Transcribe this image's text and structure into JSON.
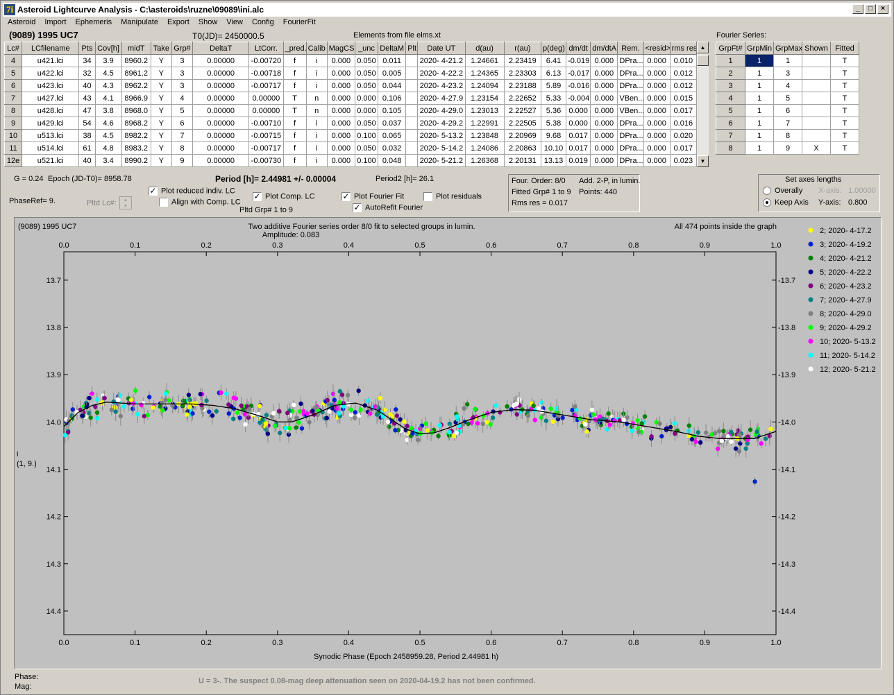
{
  "window": {
    "title": "Asteroid Lightcurve Analysis - C:\\asteroids\\ruzne\\09089\\ini.alc",
    "icon_glyph": "7i"
  },
  "menu": [
    "Asteroid",
    "Import",
    "Ephemeris",
    "Manipulate",
    "Export",
    "Show",
    "View",
    "Config",
    "FourierFit"
  ],
  "header": {
    "asteroid": "(9089) 1995 UC7",
    "t0": "T0(JD)= 2450000.5",
    "elements": "Elements from file elms.xt",
    "fourier_label": "Fourier Series:"
  },
  "lc_table": {
    "columns": [
      "Lc#",
      "LCfilename",
      "Pts",
      "Cov[h]",
      "midT",
      "Take",
      "Grp#",
      "DeltaT",
      "LtCorr.",
      "_pred.",
      "Calib",
      "MagCS",
      "_unc",
      "DeltaM",
      "Plt",
      "Date UT",
      "d(au)",
      "r(au)",
      "p(deg)",
      "dm/dt",
      "dm/dtA",
      "Rem.",
      "<resid>",
      "rms res"
    ],
    "rows": [
      [
        "4",
        "u421.lci",
        "34",
        "3.9",
        "8960.2",
        "Y",
        "3",
        "0.00000",
        "-0.00720",
        "f",
        "i",
        "0.000",
        "0.050",
        "0.011",
        "",
        "2020- 4-21.2",
        "1.24661",
        "2.23419",
        "6.41",
        "-0.019",
        "0.000",
        "DPra...",
        "0.000",
        "0.010"
      ],
      [
        "5",
        "u422.lci",
        "32",
        "4.5",
        "8961.2",
        "Y",
        "3",
        "0.00000",
        "-0.00718",
        "f",
        "i",
        "0.000",
        "0.050",
        "0.005",
        "",
        "2020- 4-22.2",
        "1.24365",
        "2.23303",
        "6.13",
        "-0.017",
        "0.000",
        "DPra...",
        "0.000",
        "0.012"
      ],
      [
        "6",
        "u423.lci",
        "40",
        "4.3",
        "8962.2",
        "Y",
        "3",
        "0.00000",
        "-0.00717",
        "f",
        "i",
        "0.000",
        "0.050",
        "0.044",
        "",
        "2020- 4-23.2",
        "1.24094",
        "2.23188",
        "5.89",
        "-0.016",
        "0.000",
        "DPra...",
        "0.000",
        "0.012"
      ],
      [
        "7",
        "u427.lci",
        "43",
        "4.1",
        "8966.9",
        "Y",
        "4",
        "0.00000",
        "0.00000",
        "T",
        "n",
        "0.000",
        "0.000",
        "0.106",
        "",
        "2020- 4-27.9",
        "1.23154",
        "2.22652",
        "5.33",
        "-0.004",
        "0.000",
        "VBen...",
        "0.000",
        "0.015"
      ],
      [
        "8",
        "u428.lci",
        "47",
        "3.8",
        "8968.0",
        "Y",
        "5",
        "0.00000",
        "0.00000",
        "T",
        "n",
        "0.000",
        "0.000",
        "0.105",
        "",
        "2020- 4-29.0",
        "1.23013",
        "2.22527",
        "5.36",
        "0.000",
        "0.000",
        "VBen...",
        "0.000",
        "0.017"
      ],
      [
        "9",
        "u429.lci",
        "54",
        "4.6",
        "8968.2",
        "Y",
        "6",
        "0.00000",
        "-0.00710",
        "f",
        "i",
        "0.000",
        "0.050",
        "0.037",
        "",
        "2020- 4-29.2",
        "1.22991",
        "2.22505",
        "5.38",
        "0.000",
        "0.000",
        "DPra...",
        "0.000",
        "0.016"
      ],
      [
        "10",
        "u513.lci",
        "38",
        "4.5",
        "8982.2",
        "Y",
        "7",
        "0.00000",
        "-0.00715",
        "f",
        "i",
        "0.000",
        "0.100",
        "0.065",
        "",
        "2020- 5-13.2",
        "1.23848",
        "2.20969",
        "9.68",
        "0.017",
        "0.000",
        "DPra...",
        "0.000",
        "0.020"
      ],
      [
        "11",
        "u514.lci",
        "61",
        "4.8",
        "8983.2",
        "Y",
        "8",
        "0.00000",
        "-0.00717",
        "f",
        "i",
        "0.000",
        "0.050",
        "0.032",
        "",
        "2020- 5-14.2",
        "1.24086",
        "2.20863",
        "10.10",
        "0.017",
        "0.000",
        "DPra...",
        "0.000",
        "0.017"
      ],
      [
        "12e",
        "u521.lci",
        "40",
        "3.4",
        "8990.2",
        "Y",
        "9",
        "0.00000",
        "-0.00730",
        "f",
        "i",
        "0.000",
        "0.100",
        "0.048",
        "",
        "2020- 5-21.2",
        "1.26368",
        "2.20131",
        "13.13",
        "0.019",
        "0.000",
        "DPra...",
        "0.000",
        "0.023"
      ]
    ]
  },
  "fourier_table": {
    "columns": [
      "GrpFt#",
      "GrpMin",
      "GrpMax",
      "Shown",
      "Fitted"
    ],
    "rows": [
      [
        "1",
        "1",
        "1",
        "",
        "T"
      ],
      [
        "2",
        "1",
        "3",
        "",
        "T"
      ],
      [
        "3",
        "1",
        "4",
        "",
        "T"
      ],
      [
        "4",
        "1",
        "5",
        "",
        "T"
      ],
      [
        "5",
        "1",
        "6",
        "",
        "T"
      ],
      [
        "6",
        "1",
        "7",
        "",
        "T"
      ],
      [
        "7",
        "1",
        "8",
        "",
        "T"
      ],
      [
        "8",
        "1",
        "9",
        "X",
        "T"
      ]
    ]
  },
  "controls": {
    "g": "G = 0.24",
    "epoch": "Epoch (JD-T0)= 8958.78",
    "period": "Period [h]= 2.44981 +/- 0.00004",
    "period2": "Period2 [h]= 26.1",
    "phaseref": "PhaseRef= 9.",
    "pltd_lc": "Pltd Lc#:",
    "pltd_grp": "Pltd Grp#  1   to   9",
    "plot_reduced": "Plot reduced indiv. LC",
    "align_comp": "Align with Comp. LC",
    "plot_comp": "Plot Comp. LC",
    "plot_fourier": "Plot Fourier Fit",
    "autorefit": "AutoRefit Fourier",
    "plot_residuals": "Plot residuals",
    "fit_info": [
      "Four. Order:  8/0",
      "Add. 2-P, in lumin.",
      "Fitted Grp# 1 to 9",
      "Points: 440",
      "Rms res     = 0.017"
    ],
    "axes_title": "Set axes lengths",
    "overally": "Overally",
    "keep_axis": "Keep Axis",
    "xaxis_label": "X-axis:",
    "xaxis_val": "1.00000",
    "yaxis_label": "Y-axis:",
    "yaxis_val": "0.800"
  },
  "plot": {
    "name": "(9089) 1995 UC7",
    "subtitle1": "Two additive Fourier series order 8/0 fit to selected groups in lumin.",
    "subtitle2": "Amplitude: 0.083",
    "inside": "All 474 points inside the graph",
    "xlabel": "Synodic Phase (Epoch 2458959.28, Period 2.44981 h)",
    "ylabel1": "i",
    "ylabel2": "(1, 9.)"
  },
  "chart_data": {
    "type": "scatter",
    "xlim": [
      0,
      1
    ],
    "ylim": [
      14.45,
      13.64
    ],
    "x_ticks": [
      0.0,
      0.1,
      0.2,
      0.3,
      0.4,
      0.5,
      0.6,
      0.7,
      0.8,
      0.9,
      1.0
    ],
    "y_ticks": [
      13.7,
      13.8,
      13.9,
      14.0,
      14.1,
      14.2,
      14.3,
      14.4
    ],
    "fourier_fit": {
      "x": [
        0,
        0.02,
        0.04,
        0.06,
        0.08,
        0.1,
        0.12,
        0.15,
        0.18,
        0.21,
        0.24,
        0.27,
        0.3,
        0.32,
        0.35,
        0.38,
        0.41,
        0.44,
        0.46,
        0.48,
        0.5,
        0.52,
        0.54,
        0.57,
        0.6,
        0.63,
        0.66,
        0.7,
        0.74,
        0.78,
        0.82,
        0.86,
        0.89,
        0.92,
        0.95,
        0.97,
        1.0
      ],
      "y": [
        14.01,
        13.98,
        13.965,
        13.958,
        13.96,
        13.962,
        13.962,
        13.962,
        13.962,
        13.965,
        13.972,
        13.985,
        14.0,
        14.0,
        13.985,
        13.965,
        13.96,
        13.975,
        13.995,
        14.015,
        14.025,
        14.023,
        14.013,
        13.995,
        13.98,
        13.974,
        13.975,
        13.985,
        13.995,
        14.0,
        14.01,
        14.02,
        14.03,
        14.035,
        14.035,
        14.035,
        14.02
      ]
    },
    "series": [
      {
        "name": "2; 2020- 4-17.2",
        "color": "#ffff00"
      },
      {
        "name": "3; 2020- 4-19.2",
        "color": "#0020d0"
      },
      {
        "name": "4; 2020- 4-21.2",
        "color": "#008000"
      },
      {
        "name": "5; 2020- 4-22.2",
        "color": "#000080"
      },
      {
        "name": "6; 2020- 4-23.2",
        "color": "#800080"
      },
      {
        "name": "7; 2020- 4-27.9",
        "color": "#008080"
      },
      {
        "name": "8; 2020- 4-29.0",
        "color": "#808080"
      },
      {
        "name": "9; 2020- 4-29.2",
        "color": "#00ff00"
      },
      {
        "name": "10; 2020- 5-13.2",
        "color": "#ff00ff"
      },
      {
        "name": "11; 2020- 5-14.2",
        "color": "#00ffff"
      },
      {
        "name": "12; 2020- 5-21.2",
        "color": "#ffffff"
      }
    ],
    "point_count": 474
  },
  "status": {
    "phase_label": "Phase:",
    "mag_label": "Mag:",
    "note": "U = 3-.  The suspect 0.08-mag deep attenuation seen on 2020-04-19.2 has not been confirmed."
  }
}
